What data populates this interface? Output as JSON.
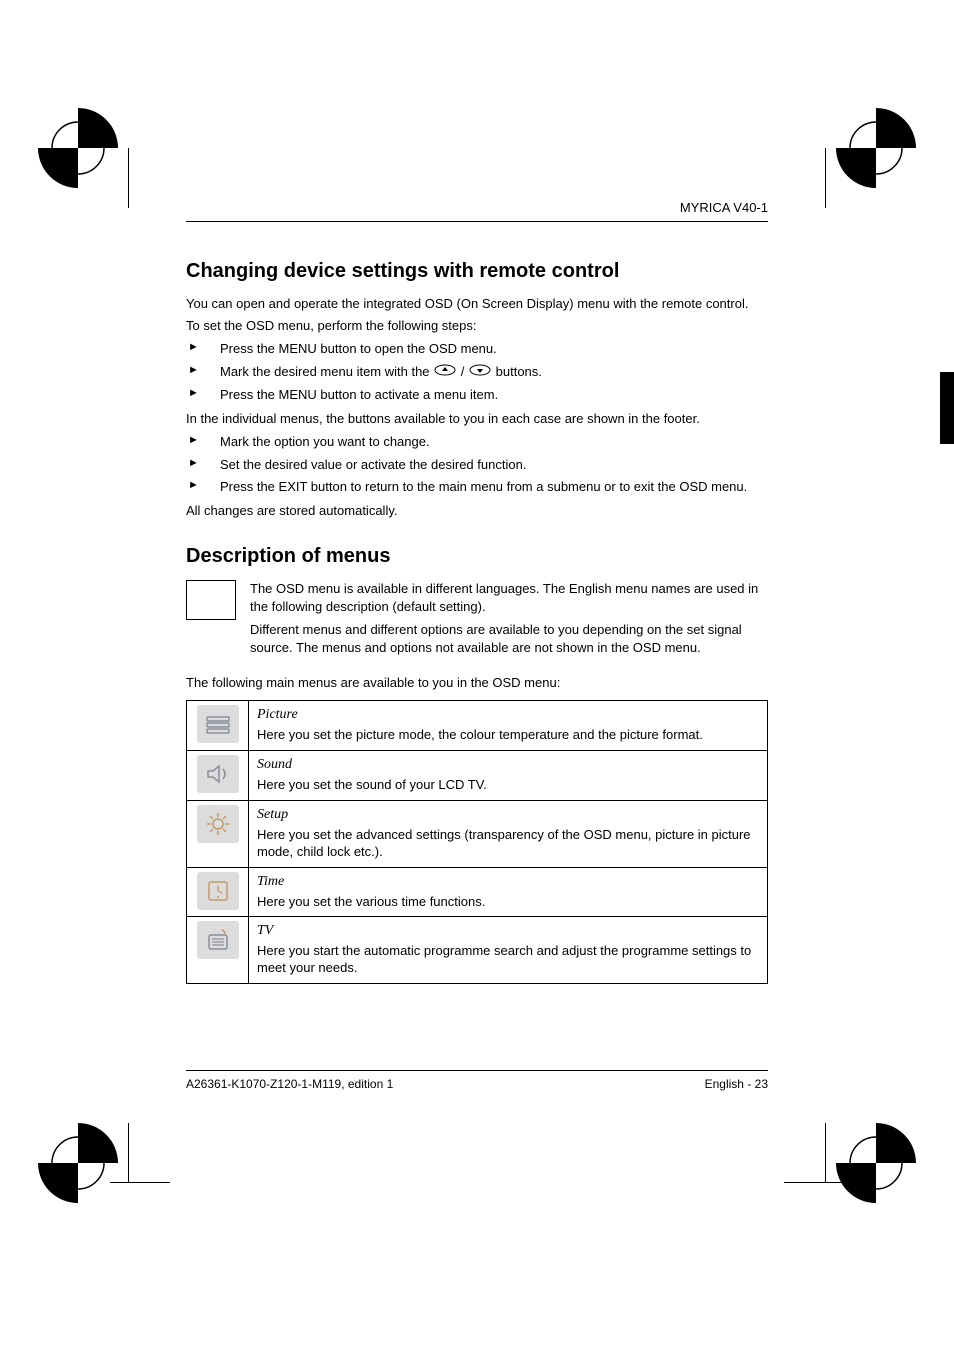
{
  "header": {
    "product": "MYRICA V40-1"
  },
  "section1": {
    "heading": "Changing device settings with remote control",
    "intro1": "You can open and operate the integrated OSD (On Screen Display) menu with the remote control.",
    "intro2": "To set the OSD menu, perform the following steps:",
    "stepsA": [
      "Press the MENU button to open the OSD menu.",
      "Mark the desired menu item with the ",
      "Press the MENU button to activate a menu item."
    ],
    "stepA2_suffix": " buttons.",
    "mid": "In the individual menus, the buttons available to you in each case are shown in the footer.",
    "stepsB": [
      "Mark the option you want to change.",
      "Set the desired value or activate the desired function.",
      "Press the EXIT button to return to the main menu from a submenu or to exit the OSD menu."
    ],
    "outro": "All changes are stored automatically."
  },
  "section2": {
    "heading": "Description of menus",
    "note1": "The OSD menu is available in different languages. The English menu names are used in the following description (default setting).",
    "note2": "Different menus and different options are available to you depending on the set signal source. The menus and options not available are not shown in the OSD menu.",
    "intro": "The following main menus are available to you in the OSD menu:",
    "menus": [
      {
        "name": "Picture",
        "desc": "Here you set the picture mode, the colour temperature and the picture format."
      },
      {
        "name": "Sound",
        "desc": "Here you set the sound of your LCD TV."
      },
      {
        "name": "Setup",
        "desc": "Here you set the advanced settings (transparency of the OSD menu, picture in picture mode, child lock etc.)."
      },
      {
        "name": "Time",
        "desc": "Here you set the various time functions."
      },
      {
        "name": "TV",
        "desc": "Here you start the automatic programme search and adjust the programme settings to meet your needs."
      }
    ]
  },
  "footer": {
    "left": "A26361-K1070-Z120-1-M119, edition 1",
    "right": "English - 23"
  }
}
